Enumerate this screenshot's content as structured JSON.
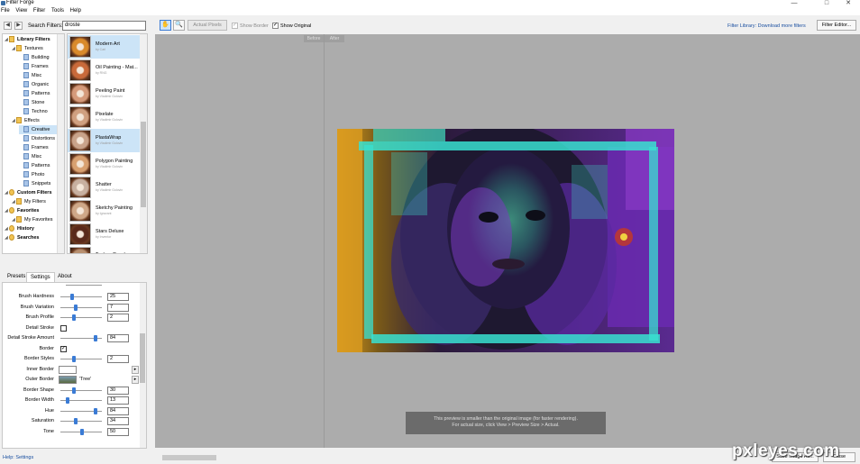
{
  "window": {
    "title": "Filter Forge",
    "minimize": "—",
    "maximize": "□",
    "close": "✕"
  },
  "menu": [
    "File",
    "View",
    "Filter",
    "Tools",
    "Help"
  ],
  "search": {
    "label": "Search Filters:",
    "value": "droste"
  },
  "tree": [
    {
      "label": "Library Filters",
      "level": 0,
      "icon": "folder",
      "bold": true
    },
    {
      "label": "Textures",
      "level": 1,
      "icon": "folder"
    },
    {
      "label": "Building",
      "level": 2,
      "icon": "doc"
    },
    {
      "label": "Frames",
      "level": 2,
      "icon": "doc"
    },
    {
      "label": "Misc",
      "level": 2,
      "icon": "doc"
    },
    {
      "label": "Organic",
      "level": 2,
      "icon": "doc"
    },
    {
      "label": "Patterns",
      "level": 2,
      "icon": "doc"
    },
    {
      "label": "Stone",
      "level": 2,
      "icon": "doc"
    },
    {
      "label": "Techno",
      "level": 2,
      "icon": "doc"
    },
    {
      "label": "Effects",
      "level": 1,
      "icon": "folder"
    },
    {
      "label": "Creative",
      "level": 2,
      "icon": "doc",
      "selected": true
    },
    {
      "label": "Distortions",
      "level": 2,
      "icon": "doc"
    },
    {
      "label": "Frames",
      "level": 2,
      "icon": "doc"
    },
    {
      "label": "Misc",
      "level": 2,
      "icon": "doc"
    },
    {
      "label": "Patterns",
      "level": 2,
      "icon": "doc"
    },
    {
      "label": "Photo",
      "level": 2,
      "icon": "doc"
    },
    {
      "label": "Snippets",
      "level": 2,
      "icon": "doc"
    },
    {
      "label": "Custom Filters",
      "level": 0,
      "icon": "star",
      "bold": true
    },
    {
      "label": "My Filters",
      "level": 1,
      "icon": "folder"
    },
    {
      "label": "Favorites",
      "level": 0,
      "icon": "star",
      "bold": true
    },
    {
      "label": "My Favorites",
      "level": 1,
      "icon": "folder"
    },
    {
      "label": "History",
      "level": 0,
      "icon": "star",
      "bold": true
    },
    {
      "label": "Searches",
      "level": 0,
      "icon": "star",
      "bold": true
    }
  ],
  "filters": [
    {
      "name": "Modern Art",
      "author": "by Carl",
      "selected": true,
      "color": "#d98a2b"
    },
    {
      "name": "Oil Painting - Mat...",
      "author": "by RNG",
      "color": "#c96a3a"
    },
    {
      "name": "Peeling Paint",
      "author": "by Vladimir Golovin",
      "color": "#d59a7a"
    },
    {
      "name": "Pixelate",
      "author": "by Vladimir Golovin",
      "color": "#d0a080"
    },
    {
      "name": "PlastaWrap",
      "author": "by Vladimir Golovin",
      "color": "#c9a38a",
      "highlight": true
    },
    {
      "name": "Polygon Painting",
      "author": "by Vladimir Golovin",
      "color": "#d8a070"
    },
    {
      "name": "Shatter",
      "author": "by Vladimir Golovin",
      "color": "#c8b0a0"
    },
    {
      "name": "Sketchy Painting",
      "author": "by Ignorant",
      "color": "#cfa888"
    },
    {
      "name": "Stars Deluxe",
      "author": "by Inventor",
      "color": "#5a2a1a"
    },
    {
      "name": "Techno Puzzle",
      "author": "",
      "color": "#b89070"
    }
  ],
  "tabs": [
    "Presets",
    "Settings",
    "About"
  ],
  "settings": [
    {
      "label": "Brush Hardness",
      "type": "slider",
      "value": "25",
      "level": 0.25
    },
    {
      "label": "Brush Variation",
      "type": "slider",
      "value": "7",
      "level": 0.35
    },
    {
      "label": "Brush Profile",
      "type": "slider",
      "value": "2",
      "level": 0.3
    },
    {
      "label": "Detail Stroke",
      "type": "check",
      "checked": false
    },
    {
      "label": "Detail Stroke Amount",
      "type": "slider",
      "value": "84",
      "level": 0.84
    },
    {
      "label": "Border",
      "type": "check",
      "checked": true
    },
    {
      "label": "Border Styles",
      "type": "slider",
      "value": "2",
      "level": 0.3
    },
    {
      "label": "Inner Border",
      "type": "image",
      "text": ""
    },
    {
      "label": "Outer Border",
      "type": "image",
      "text": "'Tree'"
    },
    {
      "label": "Border Shape",
      "type": "slider",
      "value": "30",
      "level": 0.3
    },
    {
      "label": "Border Width",
      "type": "slider",
      "value": "13",
      "level": 0.13
    },
    {
      "label": "Hue",
      "type": "slider",
      "value": "84",
      "level": 0.84
    },
    {
      "label": "Saturation",
      "type": "slider",
      "value": "34",
      "level": 0.34
    },
    {
      "label": "Tone",
      "type": "slider",
      "value": "50",
      "level": 0.5
    }
  ],
  "help": "Help: Settings",
  "toolbar": {
    "actual_pixels": "Actual Pixels",
    "show_border": "Show Border",
    "show_original": "Show Original",
    "library_link": "Filter Library: Download more filters",
    "filter_editor": "Filter Editor..."
  },
  "preview": {
    "before": "Before",
    "after": "After",
    "notice_line1": "This preview is smaller than the original image (for faster rendering).",
    "notice_line2": "For actual size, click View > Preview Size > Actual."
  },
  "bottom": {
    "save_label": "Save Image As...",
    "close_label": "Close"
  },
  "watermark": "pxleyes.com"
}
